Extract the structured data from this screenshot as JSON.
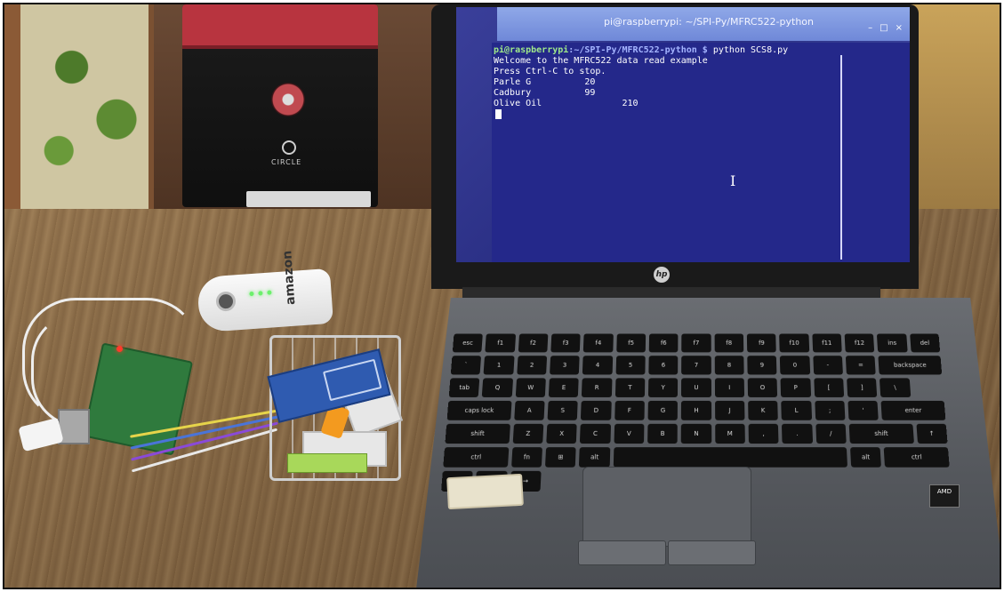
{
  "terminal": {
    "window_title": "pi@raspberrypi: ~/SPI-Py/MFRC522-python",
    "controls": [
      "–",
      "□",
      "×"
    ],
    "prompt_user": "pi@raspberrypi",
    "prompt_path": ":~/SPI-Py/MFRC522-python $",
    "command": " python SCS8.py",
    "output": [
      "Welcome to the MFRC522 data read example",
      "Press Ctrl-C to stop.",
      "Parle G          20",
      "Cadbury          99",
      "Olive Oil               210"
    ]
  },
  "scene": {
    "tower_logo": "CIRCLE",
    "powerbank_brand": "amazon",
    "laptop_logo": "hp",
    "amd_badge": "AMD"
  },
  "keyboard": {
    "rows": [
      [
        "esc",
        "f1",
        "f2",
        "f3",
        "f4",
        "f5",
        "f6",
        "f7",
        "f8",
        "f9",
        "f10",
        "f11",
        "f12",
        "ins",
        "del"
      ],
      [
        "`",
        "1",
        "2",
        "3",
        "4",
        "5",
        "6",
        "7",
        "8",
        "9",
        "0",
        "-",
        "=",
        "backspace"
      ],
      [
        "tab",
        "Q",
        "W",
        "E",
        "R",
        "T",
        "Y",
        "U",
        "I",
        "O",
        "P",
        "[",
        "]",
        "\\"
      ],
      [
        "caps lock",
        "A",
        "S",
        "D",
        "F",
        "G",
        "H",
        "J",
        "K",
        "L",
        ";",
        "'",
        "enter"
      ],
      [
        "shift",
        "Z",
        "X",
        "C",
        "V",
        "B",
        "N",
        "M",
        ",",
        ".",
        "/",
        "shift",
        "↑"
      ],
      [
        "ctrl",
        "fn",
        "⊞",
        "alt",
        "",
        "alt",
        "ctrl",
        "←",
        "↓",
        "→"
      ]
    ]
  },
  "colors": {
    "terminal_bg": "#24288a",
    "titlebar": "#7a92de",
    "prompt_user": "#9fe88a",
    "prompt_path": "#a4b4ff"
  }
}
